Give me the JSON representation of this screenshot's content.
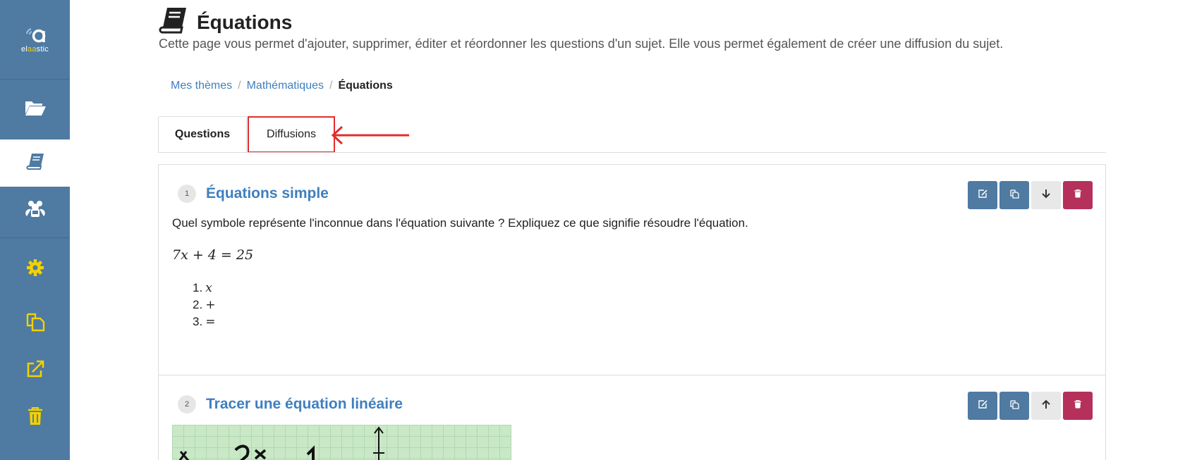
{
  "sidebar": {
    "logo": {
      "text_pre": "el",
      "text_accent": "aa",
      "text_post": "stic"
    },
    "items": [
      {
        "icon": "folder-open-icon",
        "active": false
      },
      {
        "icon": "book-icon",
        "active": true
      },
      {
        "icon": "users-icon",
        "active": false
      },
      {
        "icon": "gear-icon",
        "active": false
      },
      {
        "icon": "copy-icon",
        "active": false
      },
      {
        "icon": "external-link-icon",
        "active": false
      },
      {
        "icon": "trash-icon",
        "active": false
      }
    ]
  },
  "page": {
    "title": "Équations",
    "description": "Cette page vous permet d'ajouter, supprimer, éditer et réordonner les questions d'un sujet. Elle vous permet également de créer une diffusion du sujet."
  },
  "breadcrumb": {
    "items": [
      "Mes thèmes",
      "Mathématiques"
    ],
    "current": "Équations",
    "separator": "/"
  },
  "tabs": [
    {
      "label": "Questions",
      "active": true
    },
    {
      "label": "Diffusions",
      "active": false
    }
  ],
  "questions": [
    {
      "number": "1",
      "title": "Équations simple",
      "text": "Quel symbole représente l'inconnue dans l'équation suivante ? Expliquez ce que signifie résoudre l'équation.",
      "equation": "7x + 4 = 25",
      "choices": [
        {
          "n": "1.",
          "value": "x"
        },
        {
          "n": "2.",
          "value": "+"
        },
        {
          "n": "3.",
          "value": "="
        }
      ]
    },
    {
      "number": "2",
      "title": "Tracer une équation linéaire"
    }
  ],
  "colors": {
    "sidebar": "#4f7aa1",
    "accent": "#3f7fbf",
    "icon_yellow": "#f2d100",
    "delete": "#b5305a",
    "highlight": "#e42c2c"
  }
}
